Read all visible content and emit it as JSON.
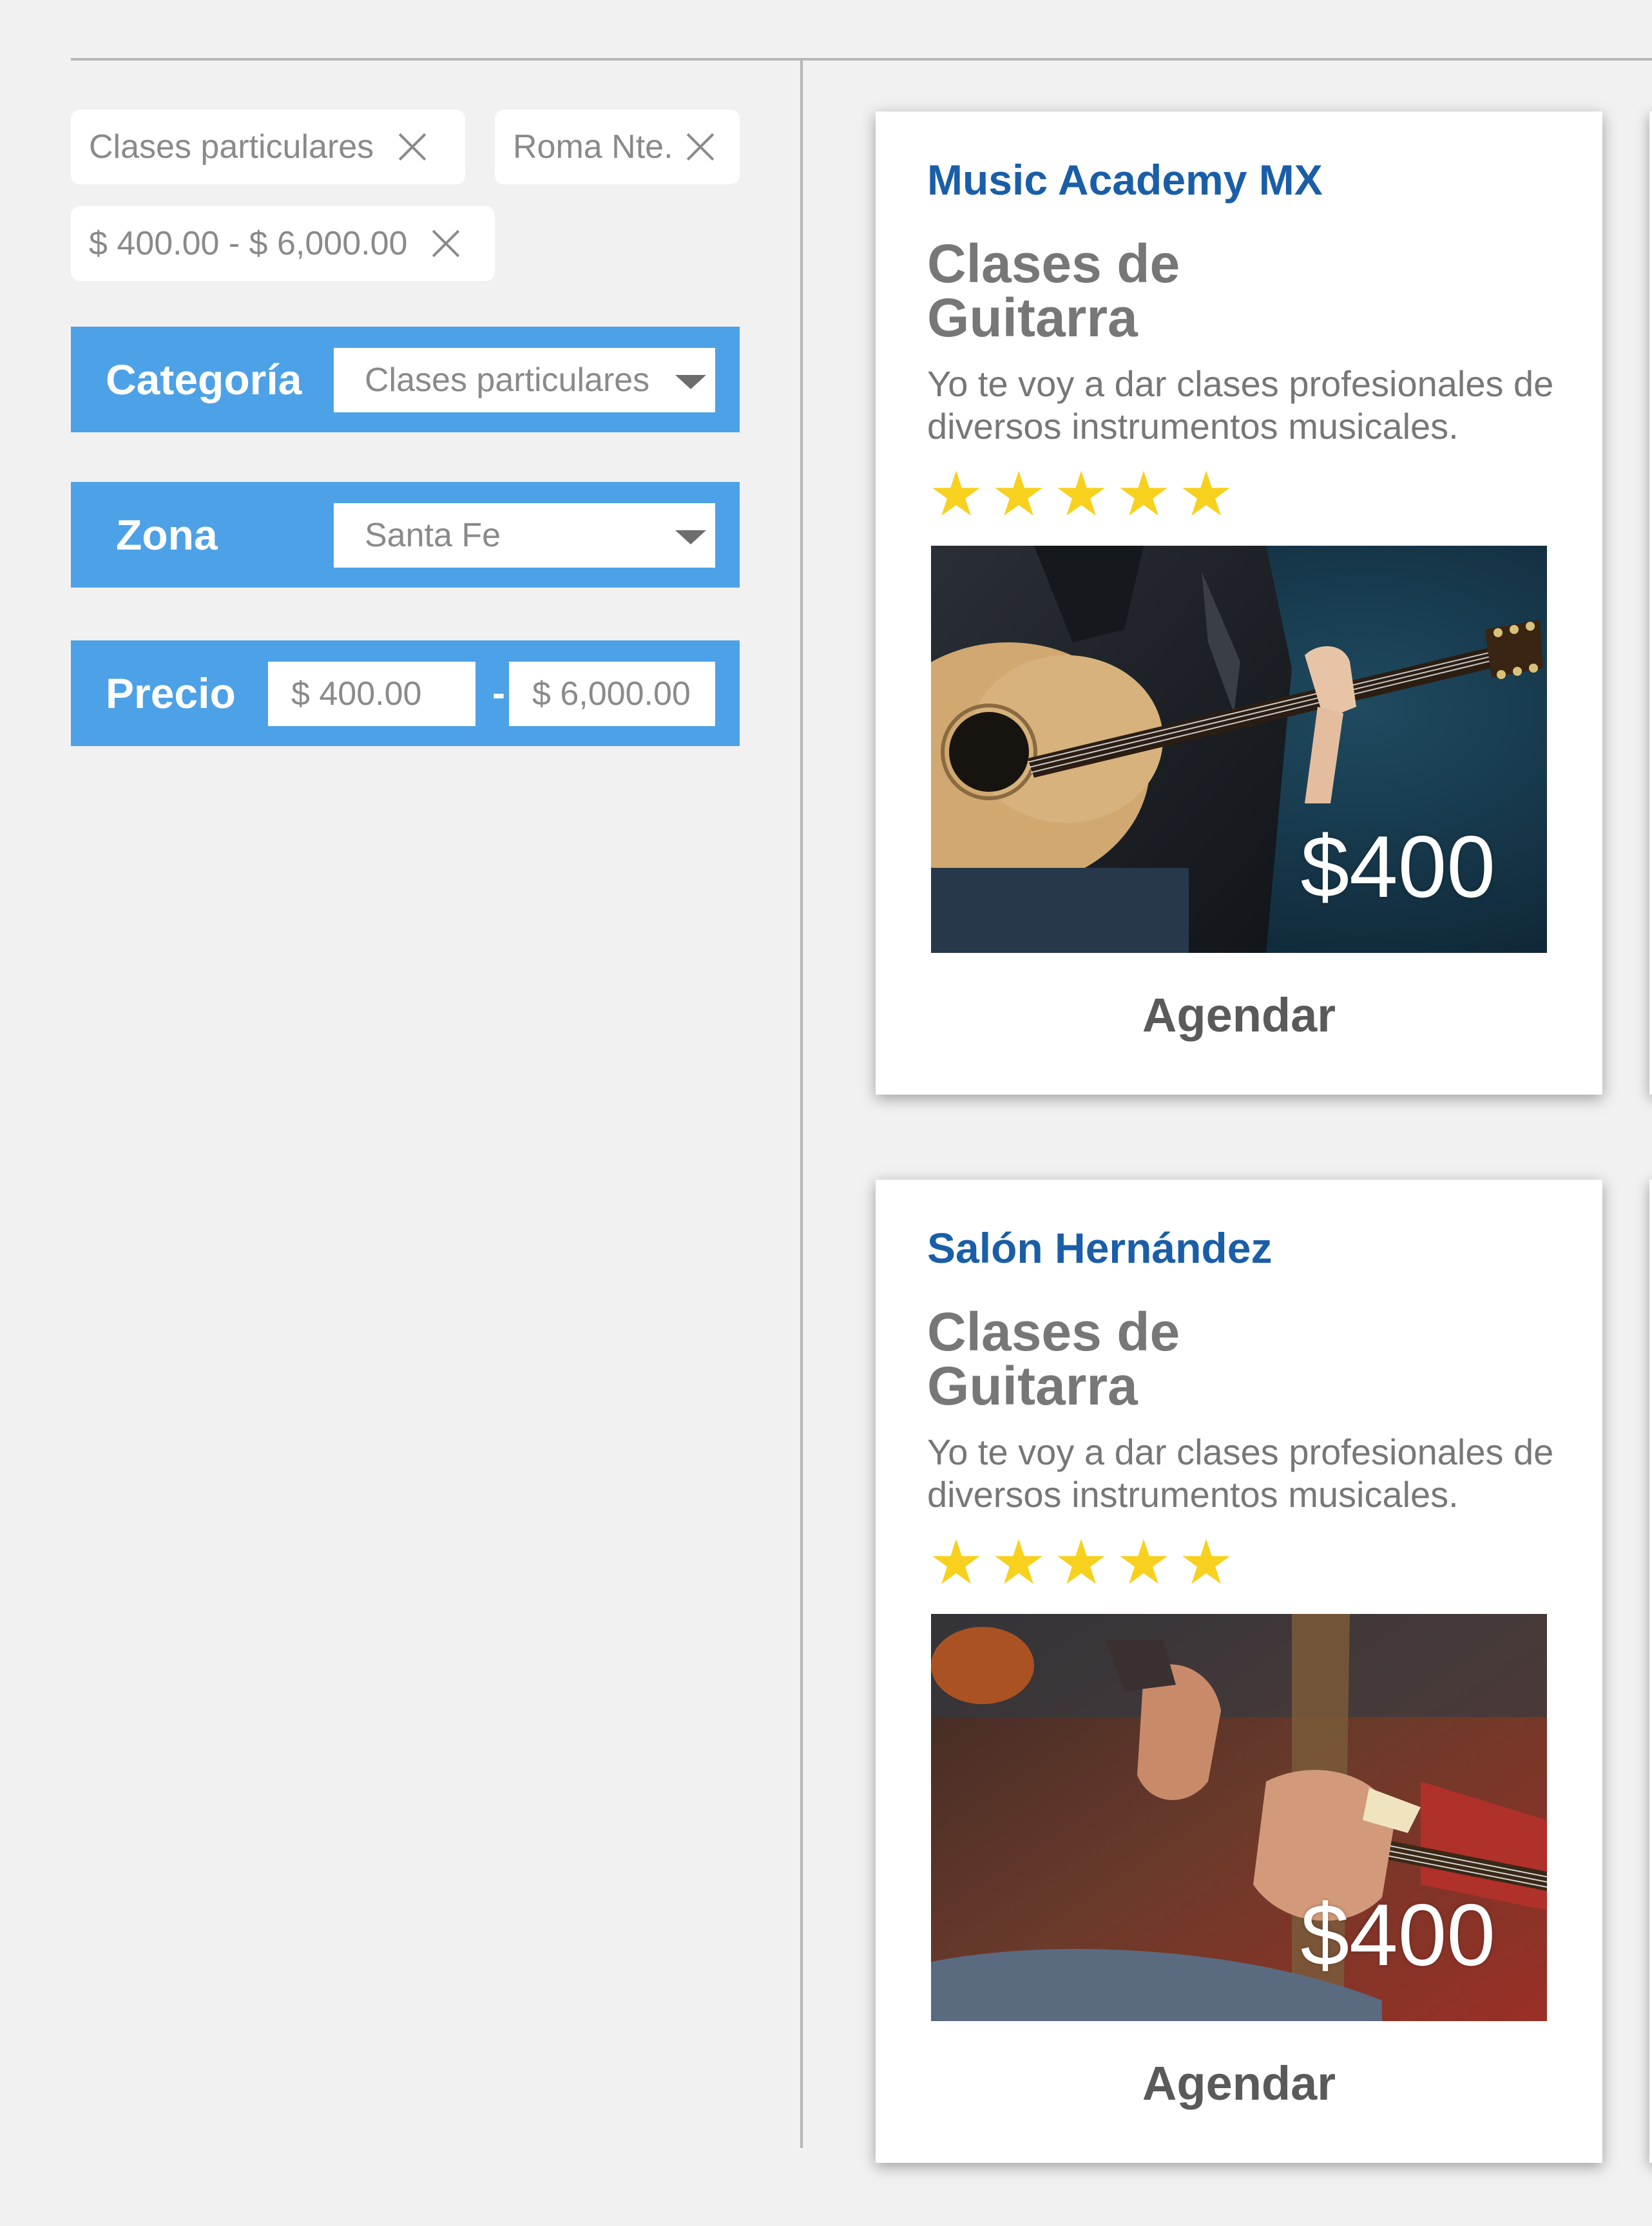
{
  "filters": {
    "chips": [
      {
        "label": "Clases particulares"
      },
      {
        "label": "Roma Nte."
      },
      {
        "label": "$ 400.00 - $ 6,000.00"
      }
    ],
    "category": {
      "label": "Categoría",
      "value": "Clases particulares"
    },
    "zone": {
      "label": "Zona",
      "value": "Santa Fe"
    },
    "price": {
      "label": "Precio",
      "min": "$ 400.00",
      "separator": "-",
      "max": "$ 6,000.00"
    }
  },
  "cards": [
    {
      "provider": "Music Academy MX",
      "title": "Clases de Guitarra",
      "description": "Yo te voy a dar clases profesionales de diversos instrumentos musicales.",
      "rating": 5,
      "price": "$400",
      "action": "Agendar"
    },
    {
      "provider": "Salón Hernández",
      "title": "Clases de Guitarra",
      "description": "Yo te voy a dar clases profesionales de diversos instrumentos musicales.",
      "rating": 5,
      "price": "$400",
      "action": "Agendar"
    }
  ],
  "colors": {
    "filter_bar": "#4da1e6",
    "provider_text": "#1a5ea8",
    "star": "#f7d11e",
    "background": "#f1f1f1"
  }
}
